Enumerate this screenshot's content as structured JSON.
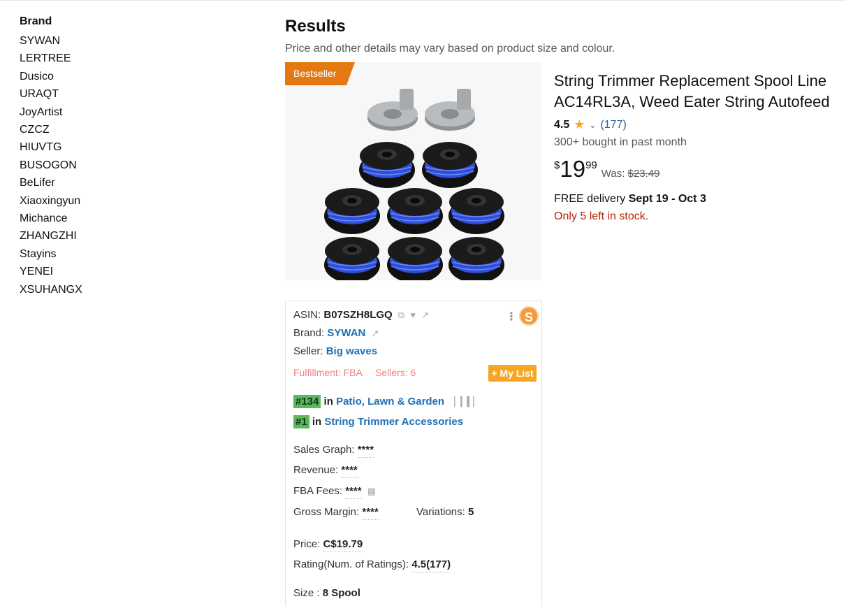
{
  "sidebar": {
    "heading": "Brand",
    "brands": [
      "SYWAN",
      "LERTREE",
      "Dusico",
      "URAQT",
      "JoyArtist",
      "CZCZ",
      "HIUVTG",
      "BUSOGON",
      "BeLifer",
      "Xiaoxingyun",
      "Michance",
      "ZHANGZHI",
      "Stayins",
      "YENEI",
      "XSUHANGX"
    ]
  },
  "results": {
    "title": "Results",
    "subtitle": "Price and other details may vary based on product size and colour."
  },
  "product": {
    "badge": "Bestseller",
    "title_line1": "String Trimmer Replacement Spool Line",
    "title_line2": "AC14RL3A, Weed Eater String Autofeed",
    "rating": "4.5",
    "rating_count": "(177)",
    "bought": "300+ bought in past month",
    "price_symbol": "$",
    "price_whole": "19",
    "price_fraction": "99",
    "was_label": "Was:",
    "was_price": "$23.49",
    "delivery_prefix": "FREE delivery",
    "delivery_dates": "Sept 19 - Oct 3",
    "stock": "Only 5 left in stock.",
    "accent_badge": "#e47911",
    "accent_stock": "#b12704"
  },
  "card": {
    "asin_label": "ASIN:",
    "asin": "B07SZH8LGQ",
    "brand_label": "Brand:",
    "brand": "SYWAN",
    "seller_label": "Seller:",
    "seller": "Big waves",
    "fulfillment": "Fulfillment: FBA",
    "sellers": "Sellers: 6",
    "mylist": "+ My List",
    "logo_letter": "S",
    "ranks": [
      {
        "rank": "#134",
        "in": "in",
        "category": "Patio, Lawn & Garden"
      },
      {
        "rank": "#1",
        "in": "in",
        "category": "String Trimmer Accessories"
      }
    ],
    "sales_graph_label": "Sales Graph:",
    "sales_graph": "****",
    "revenue_label": "Revenue:",
    "revenue": "****",
    "fba_fees_label": "FBA Fees:",
    "fba_fees": "****",
    "gross_margin_label": "Gross Margin:",
    "gross_margin": "****",
    "variations_label": "Variations:",
    "variations": "5",
    "price_label": "Price:",
    "price": "C$19.79",
    "rating_label": "Rating(Num. of Ratings):",
    "rating": "4.5(177)",
    "size_label": "Size :",
    "size": "8 Spool"
  }
}
